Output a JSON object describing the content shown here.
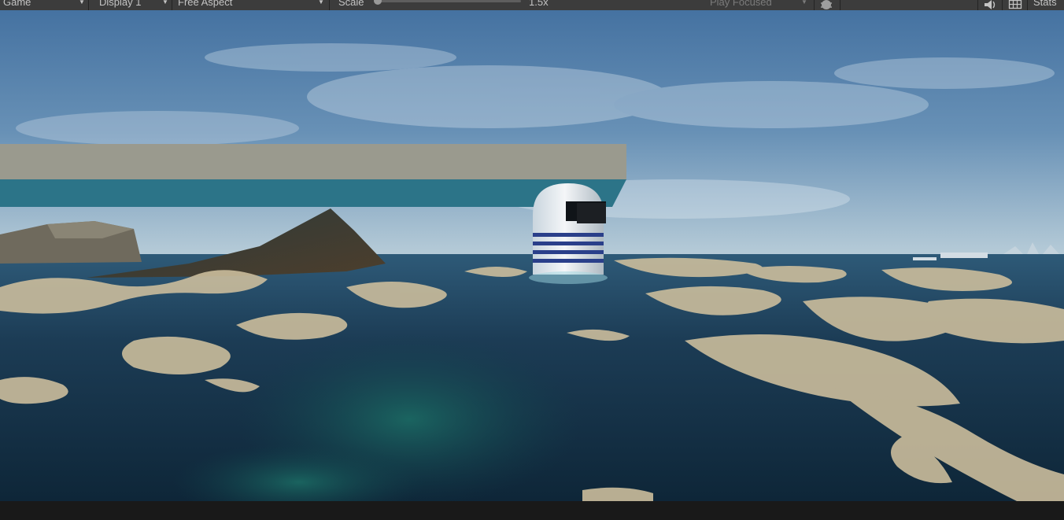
{
  "toolbar": {
    "mode_label": "Game",
    "display_label": "Display 1",
    "aspect_label": "Free Aspect",
    "scale_label": "Scale",
    "scale_value": "1.5x",
    "play_focused_label": "Play Focused",
    "stats_label": "Stats"
  },
  "icons": {
    "bug": "bug-icon",
    "audio": "speaker-icon",
    "gizmos": "grid-icon"
  },
  "colors": {
    "toolbar_bg": "#3c3c3c",
    "sky": "#5b86ac",
    "sea": "#163046",
    "foam": "#cbbd9c",
    "platform_top": "#9a9a8e",
    "platform_side": "#2c7488",
    "buoy_stripe": "#2a3f8a"
  }
}
